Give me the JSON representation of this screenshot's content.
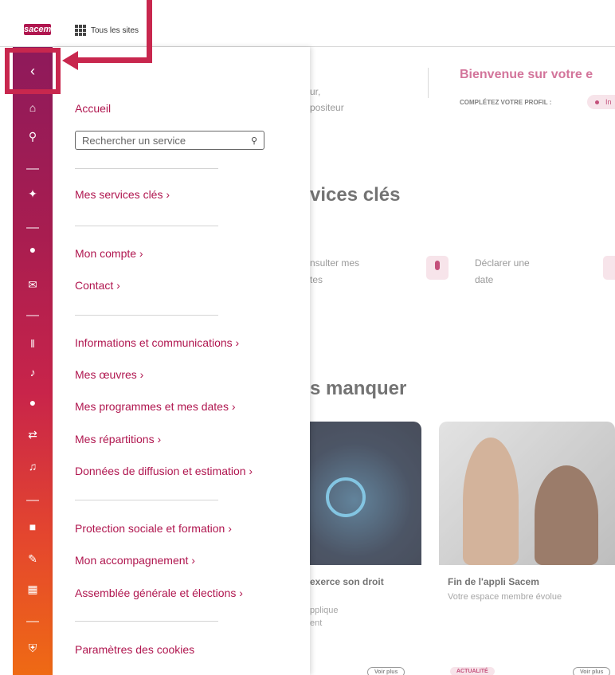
{
  "topbar": {
    "logo": "sacem",
    "sites_label": "Tous les sites"
  },
  "menu": {
    "accueil": "Accueil",
    "search_placeholder": "Rechercher un service",
    "services_cles": "Mes services clés ›",
    "compte": "Mon compte ›",
    "contact": "Contact ›",
    "informations": "Informations et communications ›",
    "oeuvres": "Mes œuvres ›",
    "programmes": "Mes programmes et mes dates ›",
    "repartitions": "Mes répartitions ›",
    "donnees": "Données de diffusion et estimation ›",
    "protection": "Protection sociale et formation ›",
    "accompagnement": "Mon accompagnement ›",
    "assemblee": "Assemblée générale et élections ›",
    "cookies": "Paramètres des cookies"
  },
  "background": {
    "p1": "ur,",
    "p2": "positeur",
    "welcome": "Bienvenue sur votre e",
    "complete_label": "COMPLÉTEZ VOTRE PROFIL :",
    "complete_item": "In",
    "services_heading": "vices clés",
    "consulter_1": "nsulter mes",
    "consulter_2": "tes",
    "declarer_1": "Déclarer une",
    "declarer_2": "date",
    "manquer_heading": "s manquer",
    "card1_title": "exerce son droit",
    "card1_sub1": "pplique",
    "card1_sub2": "ent",
    "card2_title": "Fin de l'appli Sacem",
    "card2_sub": "Votre espace membre évolue",
    "voir_plus": "Voir plus",
    "actualite": "ACTUALITÉ"
  },
  "colors": {
    "brand": "#b0164f",
    "annotation": "#c8274e",
    "sidebar_top": "#8e1a5b",
    "sidebar_bottom": "#ef6a14"
  }
}
